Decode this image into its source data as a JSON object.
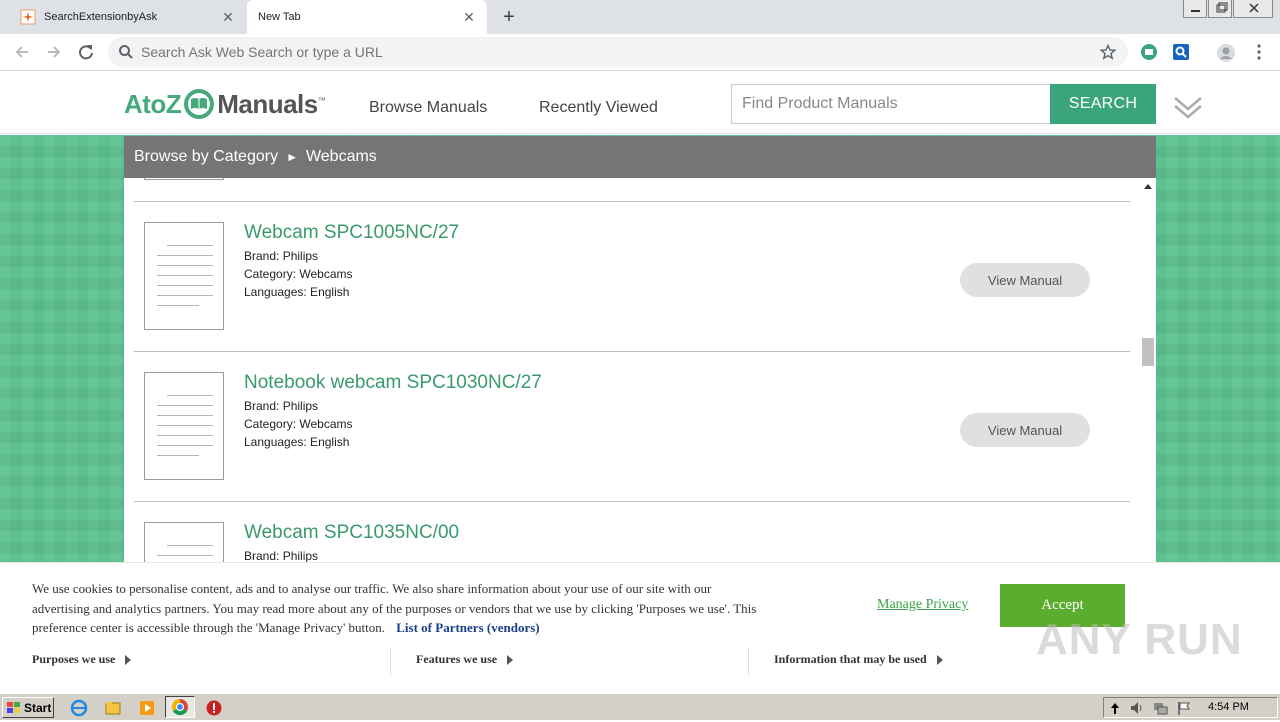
{
  "browser": {
    "tabs": [
      {
        "title": "SearchExtensionbyAsk",
        "active": false
      },
      {
        "title": "New Tab",
        "active": true
      }
    ],
    "omnibox_placeholder": "Search Ask Web Search or type a URL"
  },
  "site": {
    "logo": {
      "part1": "AtoZ",
      "part2": "Manuals",
      "tm": "™"
    },
    "nav": [
      "Browse Manuals",
      "Recently Viewed"
    ],
    "search_placeholder": "Find Product Manuals",
    "search_button": "SEARCH",
    "accent_color": "#3aa57a"
  },
  "breadcrumb": {
    "root": "Browse by Category",
    "separator": "►",
    "current": "Webcams"
  },
  "products": [
    {
      "title": "Webcam SPC1005NC/27",
      "brand": "Brand: Philips",
      "category": "Category: Webcams",
      "languages": "Languages: English",
      "button": "View Manual"
    },
    {
      "title": "Notebook webcam SPC1030NC/27",
      "brand": "Brand: Philips",
      "category": "Category: Webcams",
      "languages": "Languages: English",
      "button": "View Manual"
    },
    {
      "title": "Webcam SPC1035NC/00",
      "brand": "Brand: Philips"
    }
  ],
  "cookie": {
    "text": "We use cookies to personalise content, ads and to analyse our traffic. We also share information about your use of our site with our advertising and analytics partners. You may read more about any of the purposes or vendors that we use by clicking 'Purposes we use'. This preference center is accessible through the 'Manage Privacy' button.",
    "partners_link": "List of Partners (vendors)",
    "manage_link": "Manage Privacy",
    "accept": "Accept",
    "tabs": [
      "Purposes we use",
      "Features we use",
      "Information that may be used"
    ]
  },
  "watermark": "ANY RUN",
  "taskbar": {
    "start": "Start",
    "time": "4:54 PM"
  }
}
